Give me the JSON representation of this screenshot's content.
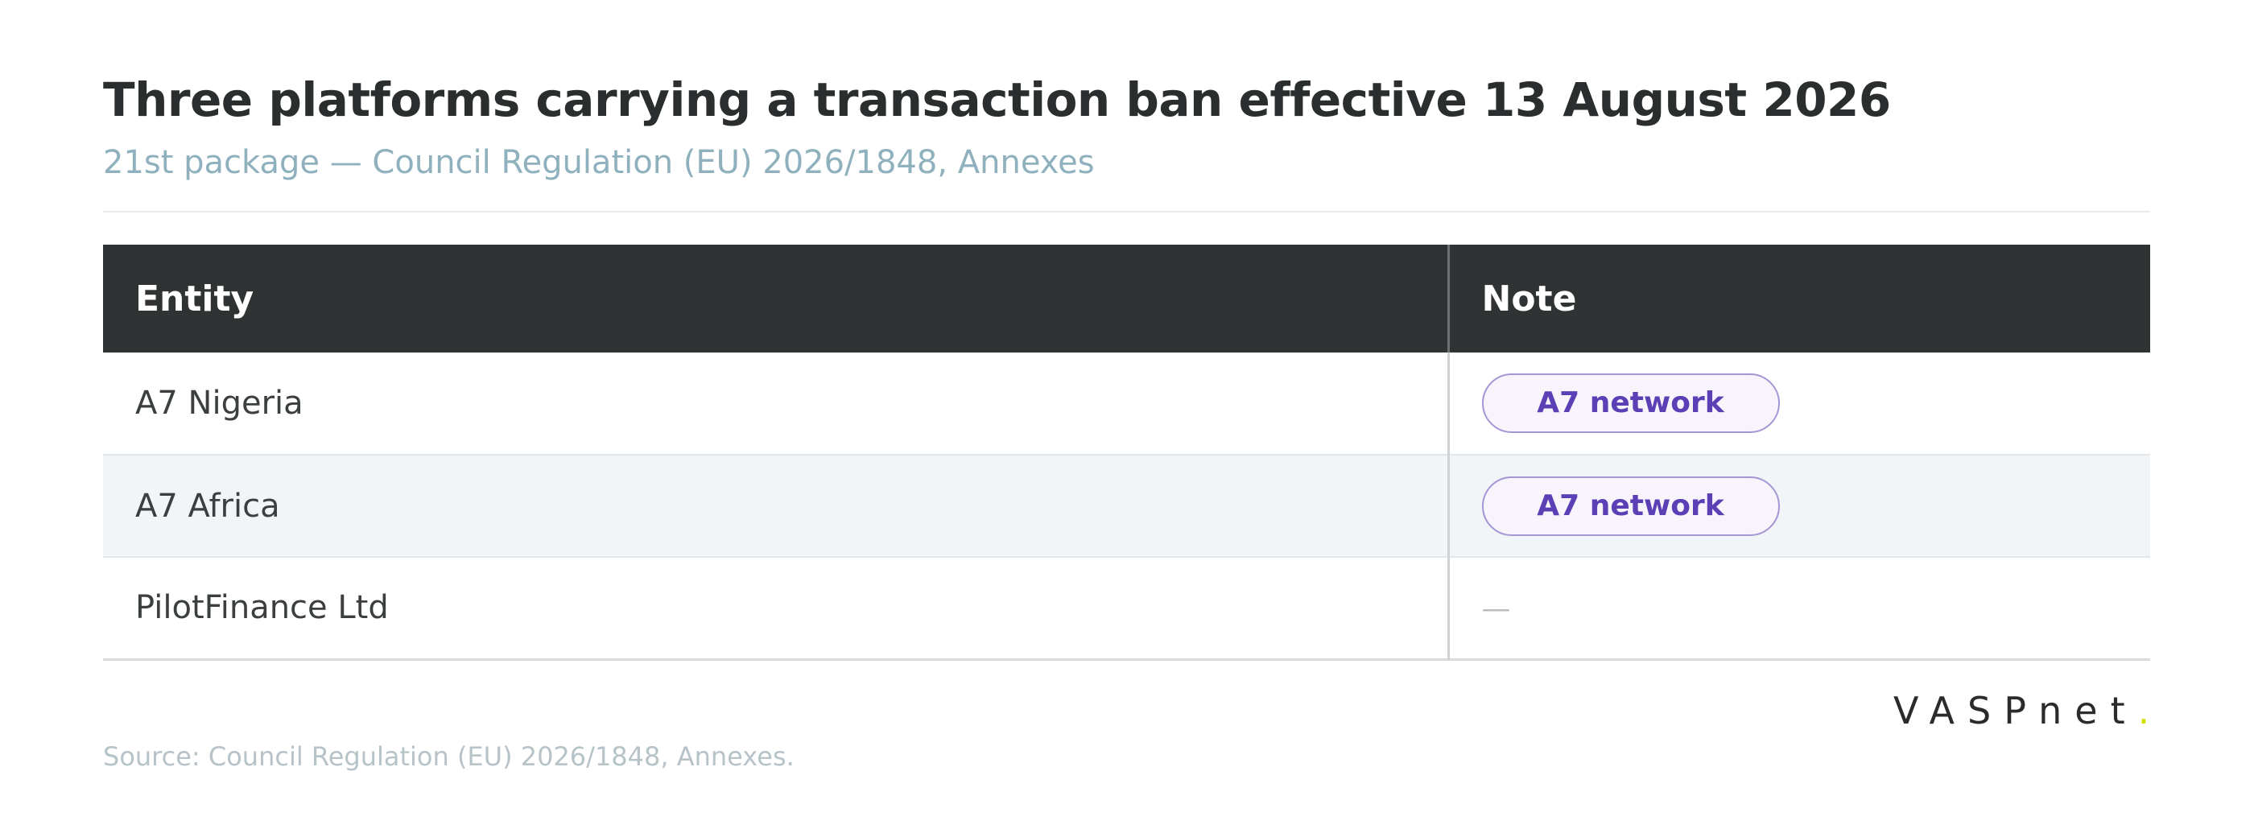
{
  "header": {
    "title": "Three platforms carrying a transaction ban effective 13 August 2026",
    "subtitle": "21st package — Council Regulation (EU) 2026/1848, Annexes"
  },
  "table": {
    "columns": [
      "Entity",
      "Note"
    ],
    "rows": [
      {
        "entity": "A7 Nigeria",
        "note": "A7 network"
      },
      {
        "entity": "A7 Africa",
        "note": "A7 network"
      },
      {
        "entity": "PilotFinance Ltd",
        "note": "—"
      }
    ]
  },
  "brand": {
    "logo_text": "VASPnet",
    "logo_dot": ".",
    "accent_color": "#d6e000"
  },
  "footer": {
    "source": "Source: Council Regulation (EU) 2026/1848, Annexes."
  },
  "colors": {
    "header_bg": "#303333",
    "pill_text": "#5b3fb5",
    "pill_border": "#a596d4",
    "subtitle": "#8fb1bd"
  }
}
